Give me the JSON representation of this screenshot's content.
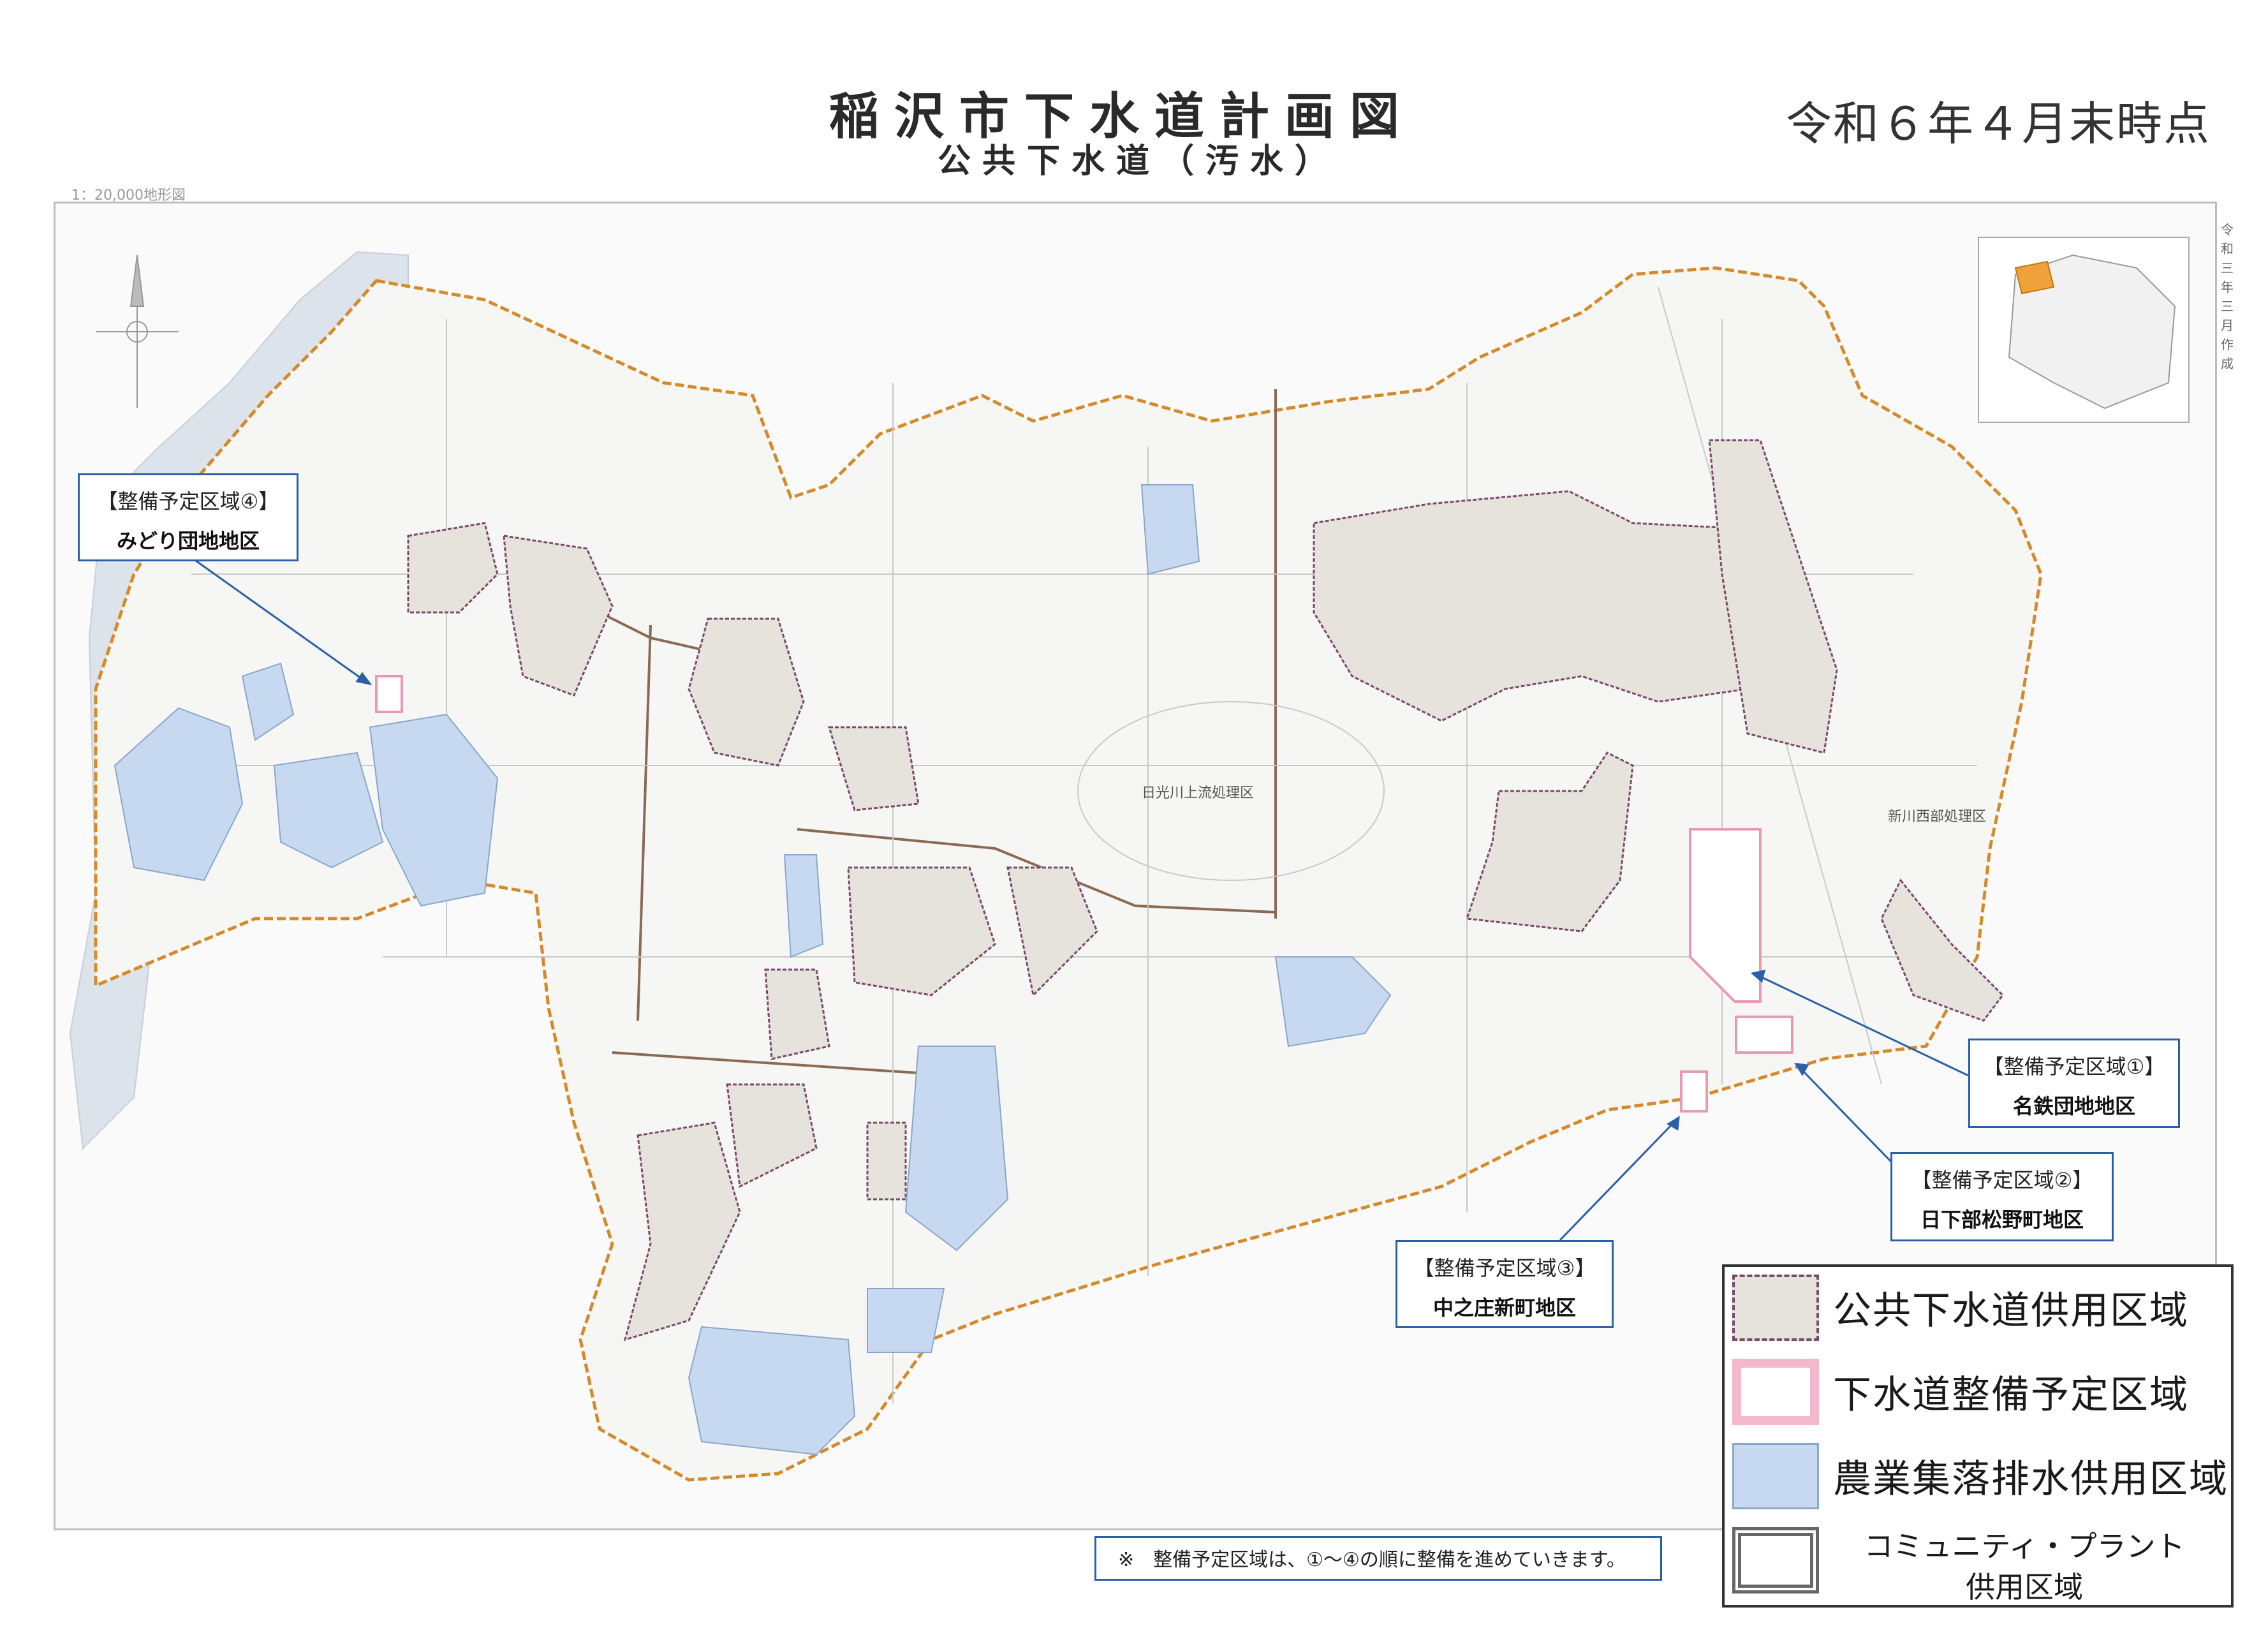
{
  "header": {
    "title": "稲沢市下水道計画図",
    "subtitle": "公共下水道（汚水）",
    "date": "令和６年４月末時点",
    "scale": "1：20,000地形図"
  },
  "side_note": "令和三年三月作成",
  "callouts": [
    {
      "id": "4",
      "line1": "【整備予定区域④】",
      "line2": "みどり団地地区"
    },
    {
      "id": "1",
      "line1": "【整備予定区域①】",
      "line2": "名鉄団地地区"
    },
    {
      "id": "2",
      "line1": "【整備予定区域②】",
      "line2": "日下部松野町地区"
    },
    {
      "id": "3",
      "line1": "【整備予定区域③】",
      "line2": "中之庄新町地区"
    }
  ],
  "note": "※　整備予定区域は、①～④の順に整備を進めていきます。",
  "legend": {
    "items": [
      {
        "label": "公共下水道供用区域",
        "swatch": "public"
      },
      {
        "label": "下水道整備予定区域",
        "swatch": "planned"
      },
      {
        "label": "農業集落排水供用区域",
        "swatch": "agri"
      },
      {
        "label_line1": "コミュニティ・プラント",
        "label_line2": "供用区域",
        "swatch": "community"
      }
    ]
  },
  "map_labels": {
    "nikkogawa": "日光川上流処理区",
    "shinkawa": "新川西部処理区"
  },
  "colors": {
    "public_fill": "#e6e2dc",
    "public_border": "#7a4a6a",
    "planned_fill": "#ffffff",
    "planned_border": "#e79ab6",
    "agri_fill": "#c7d9f0",
    "agri_border": "#8aa6cc",
    "city_boundary": "#d58a2a",
    "callout_border": "#2b5fa8"
  }
}
